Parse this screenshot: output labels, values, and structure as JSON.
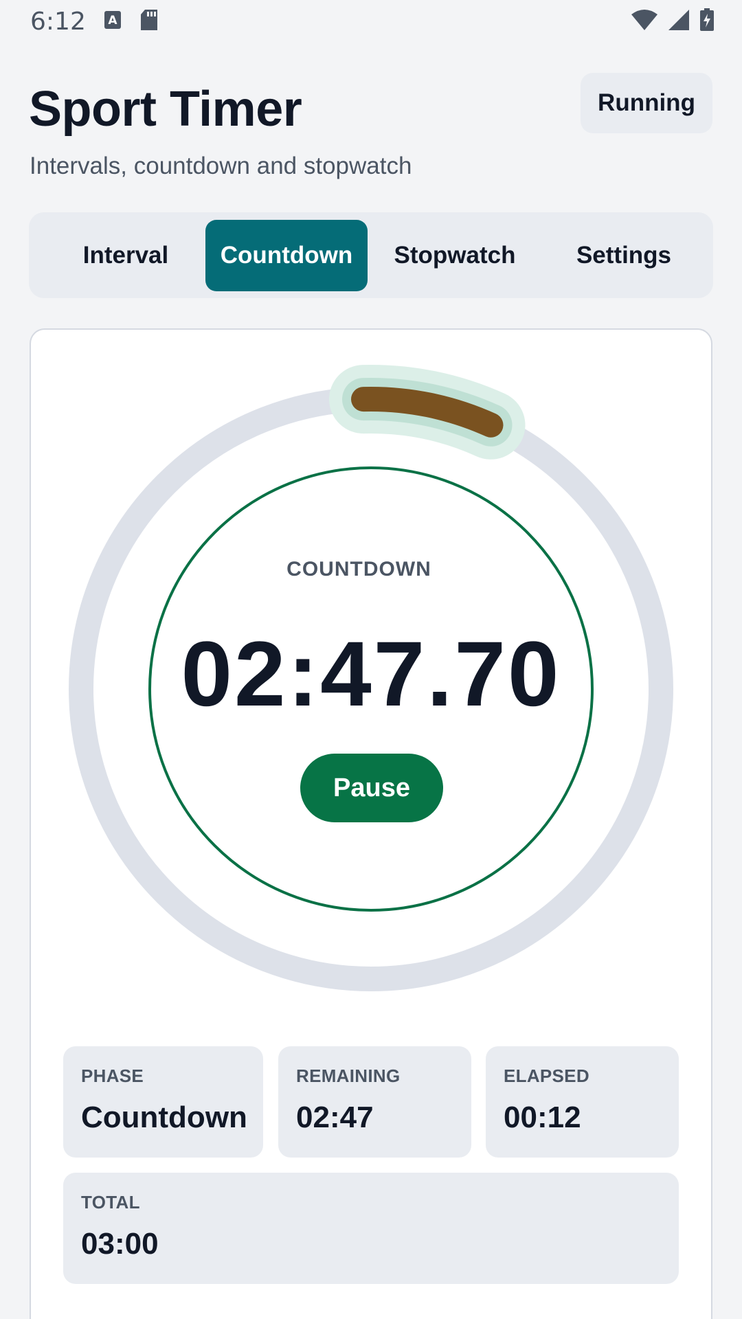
{
  "status_bar": {
    "time": "6:12",
    "icons": [
      "a-notification-icon",
      "sd-card-icon",
      "wifi-icon",
      "signal-icon",
      "battery-charging-icon"
    ]
  },
  "header": {
    "title": "Sport Timer",
    "subtitle": "Intervals, countdown and stopwatch",
    "state": "Running"
  },
  "tabs": [
    {
      "label": "Interval",
      "active": false
    },
    {
      "label": "Countdown",
      "active": true
    },
    {
      "label": "Stopwatch",
      "active": false
    },
    {
      "label": "Settings",
      "active": false
    }
  ],
  "timer": {
    "mode_label": "COUNTDOWN",
    "display": "02:47.70",
    "action_label": "Pause",
    "progress_fraction": 0.072
  },
  "stats": {
    "phase": {
      "label": "PHASE",
      "value": "Countdown"
    },
    "remaining": {
      "label": "REMAINING",
      "value": "02:47"
    },
    "elapsed": {
      "label": "ELAPSED",
      "value": "00:12"
    },
    "total": {
      "label": "TOTAL",
      "value": "03:00"
    }
  },
  "colors": {
    "accent_tab": "#056c77",
    "running_green": "#077446",
    "progress_arc": "#7a5220",
    "track": "#dde1e9"
  }
}
